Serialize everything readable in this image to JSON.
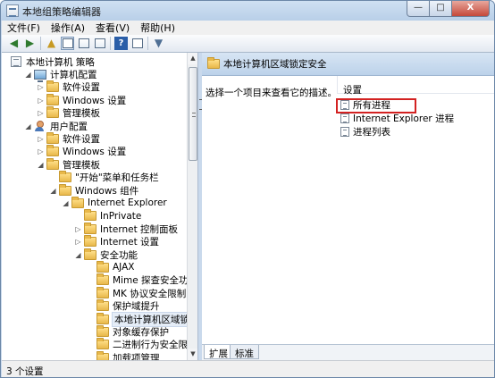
{
  "window": {
    "title": "本地组策略编辑器",
    "minimize": "—",
    "maximize": "□",
    "close": "X"
  },
  "menu": [
    "文件(F)",
    "操作(A)",
    "查看(V)",
    "帮助(H)"
  ],
  "toolbar": {
    "back": "◆",
    "forward": "▶",
    "up": "▲",
    "help": "?",
    "filter": "▼",
    "icons": [
      "back-arrow-icon",
      "forward-arrow-icon",
      "up-folder-icon",
      "show-hide-tree-icon",
      "refresh-icon",
      "export-list-icon",
      "help-icon",
      "properties-icon",
      "filter-icon"
    ]
  },
  "tree": [
    {
      "label": "本地计算机 策略",
      "level": 0,
      "twisty": "",
      "icon": "policy"
    },
    {
      "label": "计算机配置",
      "level": 1,
      "twisty": "◢",
      "icon": "computer"
    },
    {
      "label": "软件设置",
      "level": 2,
      "twisty": "▷",
      "icon": "folder"
    },
    {
      "label": "Windows 设置",
      "level": 2,
      "twisty": "▷",
      "icon": "folder"
    },
    {
      "label": "管理模板",
      "level": 2,
      "twisty": "▷",
      "icon": "folder"
    },
    {
      "label": "用户配置",
      "level": 1,
      "twisty": "◢",
      "icon": "user"
    },
    {
      "label": "软件设置",
      "level": 2,
      "twisty": "▷",
      "icon": "folder"
    },
    {
      "label": "Windows 设置",
      "level": 2,
      "twisty": "▷",
      "icon": "folder"
    },
    {
      "label": "管理模板",
      "level": 2,
      "twisty": "◢",
      "icon": "folder"
    },
    {
      "label": "\"开始\"菜单和任务栏",
      "level": 3,
      "twisty": "",
      "icon": "folder"
    },
    {
      "label": "Windows 组件",
      "level": 3,
      "twisty": "◢",
      "icon": "folder"
    },
    {
      "label": "Internet Explorer",
      "level": 4,
      "twisty": "◢",
      "icon": "folder"
    },
    {
      "label": "InPrivate",
      "level": 5,
      "twisty": "",
      "icon": "folder"
    },
    {
      "label": "Internet 控制面板",
      "level": 5,
      "twisty": "▷",
      "icon": "folder"
    },
    {
      "label": "Internet 设置",
      "level": 5,
      "twisty": "▷",
      "icon": "folder"
    },
    {
      "label": "安全功能",
      "level": 5,
      "twisty": "◢",
      "icon": "folder"
    },
    {
      "label": "AJAX",
      "level": 6,
      "twisty": "",
      "icon": "folder"
    },
    {
      "label": "Mime 探查安全功能",
      "level": 6,
      "twisty": "",
      "icon": "folder"
    },
    {
      "label": "MK 协议安全限制",
      "level": 6,
      "twisty": "",
      "icon": "folder"
    },
    {
      "label": "保护域提升",
      "level": 6,
      "twisty": "",
      "icon": "folder"
    },
    {
      "label": "本地计算机区域锁定安全",
      "level": 6,
      "twisty": "",
      "icon": "folder",
      "selected": true
    },
    {
      "label": "对象缓存保护",
      "level": 6,
      "twisty": "",
      "icon": "folder"
    },
    {
      "label": "二进制行为安全限制",
      "level": 6,
      "twisty": "",
      "icon": "folder"
    },
    {
      "label": "加载项管理",
      "level": 6,
      "twisty": "",
      "icon": "folder"
    }
  ],
  "scrollbar": {
    "up": "▲",
    "down": "▼"
  },
  "content": {
    "header": "本地计算机区域锁定安全",
    "description": "选择一个项目来查看它的描述。",
    "settings_header": "设置",
    "settings": [
      "所有进程",
      "Internet Explorer 进程",
      "进程列表"
    ]
  },
  "tabs": [
    "扩展",
    "标准"
  ],
  "status": "3 个设置"
}
